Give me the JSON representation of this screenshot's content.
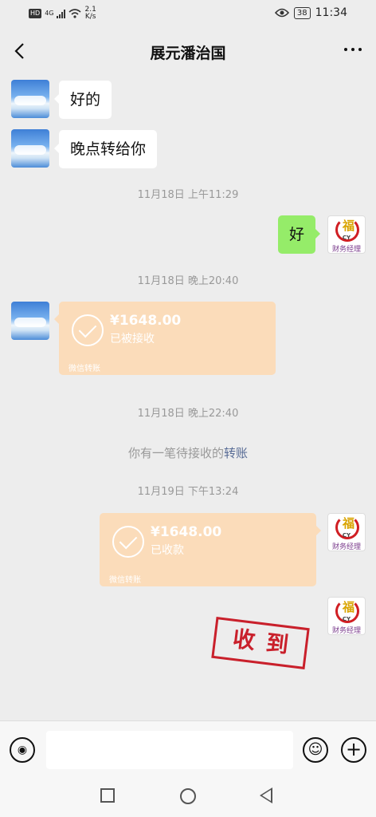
{
  "status_bar": {
    "hd": "HD",
    "signal": "4G",
    "net_speed": "2.1",
    "net_unit": "K/s",
    "battery": "38",
    "time": "11:34"
  },
  "header": {
    "title": "展元潘治国"
  },
  "messages": {
    "m1": "好的",
    "m2": "晚点转给你",
    "ts1": "11月18日 上午11:29",
    "m3": "好",
    "ts2": "11月18日 晚上20:40",
    "transfer1": {
      "amount": "¥1648.00",
      "status": "已被接收",
      "brand": "微信转账"
    },
    "ts3": "11月18日 晚上22:40",
    "sys_prefix": "你有一笔待接收的",
    "sys_link": "转账",
    "ts4": "11月19日 下午13:24",
    "transfer2": {
      "amount": "¥1648.00",
      "status": "已收款",
      "brand": "微信转账"
    },
    "stamp": "收到"
  },
  "avatar_logo": {
    "symbol": "福",
    "brand": "CY",
    "caption": "财务经理"
  },
  "icons": {
    "voice": "◉",
    "emoji": "☺",
    "plus": "+"
  }
}
